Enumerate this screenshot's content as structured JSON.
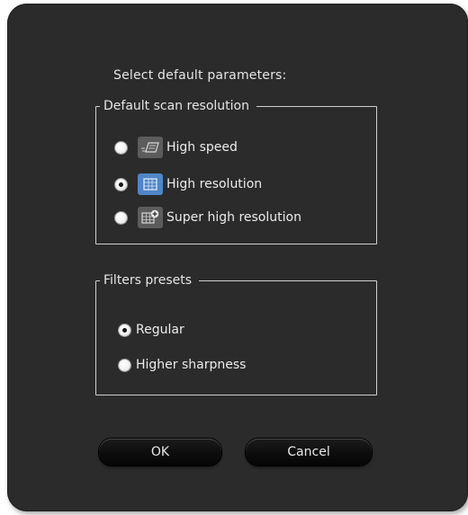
{
  "dialog": {
    "title": "Select default parameters:"
  },
  "scan_resolution": {
    "legend": "Default scan resolution",
    "options": [
      {
        "label": "High speed",
        "icon": "high-speed-icon",
        "selected": false
      },
      {
        "label": "High resolution",
        "icon": "high-resolution-icon",
        "selected": true
      },
      {
        "label": "Super high resolution",
        "icon": "super-high-resolution-icon",
        "selected": false
      }
    ]
  },
  "filters": {
    "legend": "Filters presets",
    "options": [
      {
        "label": "Regular",
        "selected": true
      },
      {
        "label": "Higher sharpness",
        "selected": false
      }
    ]
  },
  "buttons": {
    "ok": "OK",
    "cancel": "Cancel"
  },
  "colors": {
    "dialog_background": "#2b2b2b",
    "selected_icon_accent": "#4f86c6"
  }
}
